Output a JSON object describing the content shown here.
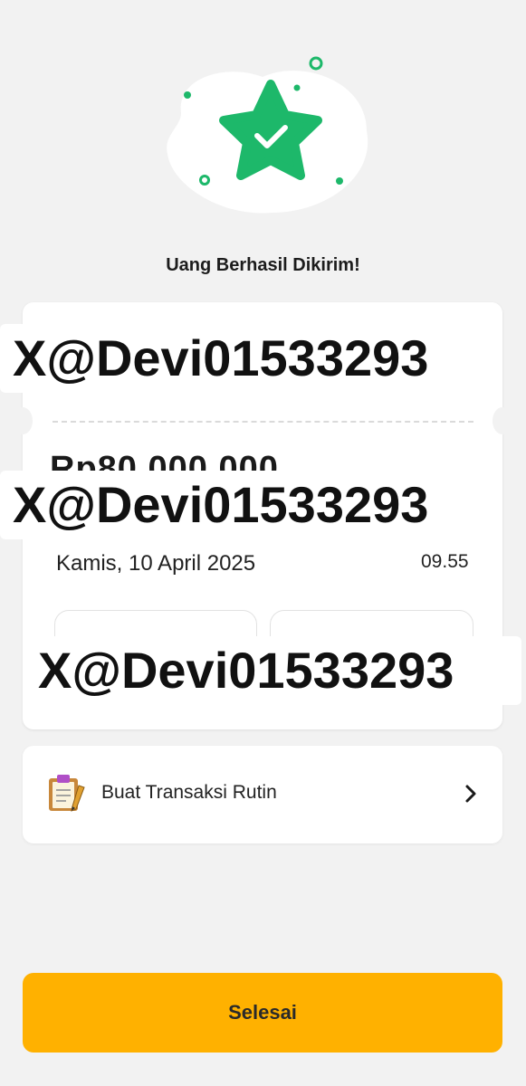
{
  "header": {
    "illustration_icon": "star-check-icon",
    "title": "Uang Berhasil Dikirim!"
  },
  "receipt": {
    "amount_partial": "Rp80.000.000",
    "date": "Kamis, 10 April 2025",
    "time": "09.55"
  },
  "watermarks": [
    "X@Devi01533293",
    "X@Devi01533293",
    "X@Devi01533293"
  ],
  "routine": {
    "icon": "clipboard-icon",
    "label": "Buat Transaksi Rutin",
    "chevron": "chevron-right-icon"
  },
  "actions": {
    "finish_label": "Selesai"
  },
  "colors": {
    "accent_green": "#1db86a",
    "button_yellow": "#ffb100",
    "background": "#f2f2f2"
  }
}
